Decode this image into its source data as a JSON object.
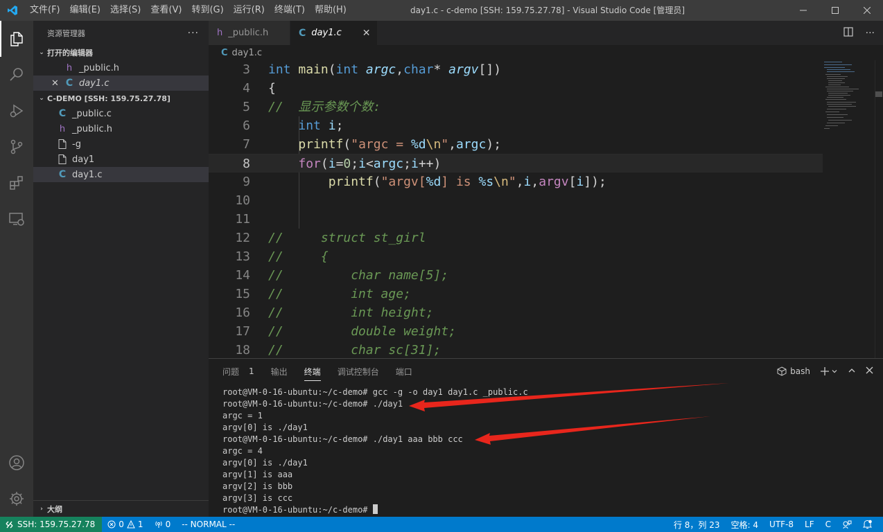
{
  "titlebar": {
    "menus": [
      "文件(F)",
      "编辑(E)",
      "选择(S)",
      "查看(V)",
      "转到(G)",
      "运行(R)",
      "终端(T)",
      "帮助(H)"
    ],
    "window_title": "day1.c - c-demo [SSH: 159.75.27.78] - Visual Studio Code [管理员]"
  },
  "sidebar": {
    "title": "资源管理器",
    "open_editors_label": "打开的编辑器",
    "open_editors": [
      {
        "icon": "h",
        "name": "_public.h"
      },
      {
        "icon": "C",
        "name": "day1.c"
      }
    ],
    "folder_label": "C-DEMO [SSH: 159.75.27.78]",
    "files": [
      {
        "icon": "C",
        "name": "_public.c"
      },
      {
        "icon": "h",
        "name": "_public.h"
      },
      {
        "icon": "file",
        "name": "-g"
      },
      {
        "icon": "file",
        "name": "day1"
      },
      {
        "icon": "C",
        "name": "day1.c"
      }
    ],
    "outline_label": "大纲"
  },
  "editor": {
    "tabs": [
      {
        "icon": "h",
        "label": "_public.h"
      },
      {
        "icon": "C",
        "label": "day1.c"
      }
    ],
    "breadcrumb": "day1.c",
    "line_numbers": [
      "3",
      "4",
      "5",
      "6",
      "7",
      "8",
      "9",
      "10",
      "11",
      "12",
      "13",
      "14",
      "15",
      "16",
      "17",
      "18"
    ],
    "active_line": "8"
  },
  "panel": {
    "tabs": [
      {
        "label": "问题",
        "badge": "1"
      },
      {
        "label": "输出"
      },
      {
        "label": "终端"
      },
      {
        "label": "调试控制台"
      },
      {
        "label": "端口"
      }
    ],
    "shell": "bash",
    "terminal_lines": [
      "root@VM-0-16-ubuntu:~/c-demo# gcc -g -o day1 day1.c _public.c",
      "root@VM-0-16-ubuntu:~/c-demo# ./day1",
      "argc = 1",
      "argv[0] is ./day1",
      "root@VM-0-16-ubuntu:~/c-demo# ./day1 aaa bbb ccc",
      "argc = 4",
      "argv[0] is ./day1",
      "argv[1] is aaa",
      "argv[2] is bbb",
      "argv[3] is ccc",
      "root@VM-0-16-ubuntu:~/c-demo# "
    ]
  },
  "statusbar": {
    "remote": "SSH: 159.75.27.78",
    "errors": "0",
    "warnings": "1",
    "ports": "0",
    "mode": "-- NORMAL --",
    "position": "行 8，列 23",
    "spaces": "空格: 4",
    "encoding": "UTF-8",
    "eol": "LF",
    "language": "C"
  },
  "colors": {
    "accent": "#007acc",
    "remote": "#16825d",
    "arrow": "#e8261c"
  }
}
